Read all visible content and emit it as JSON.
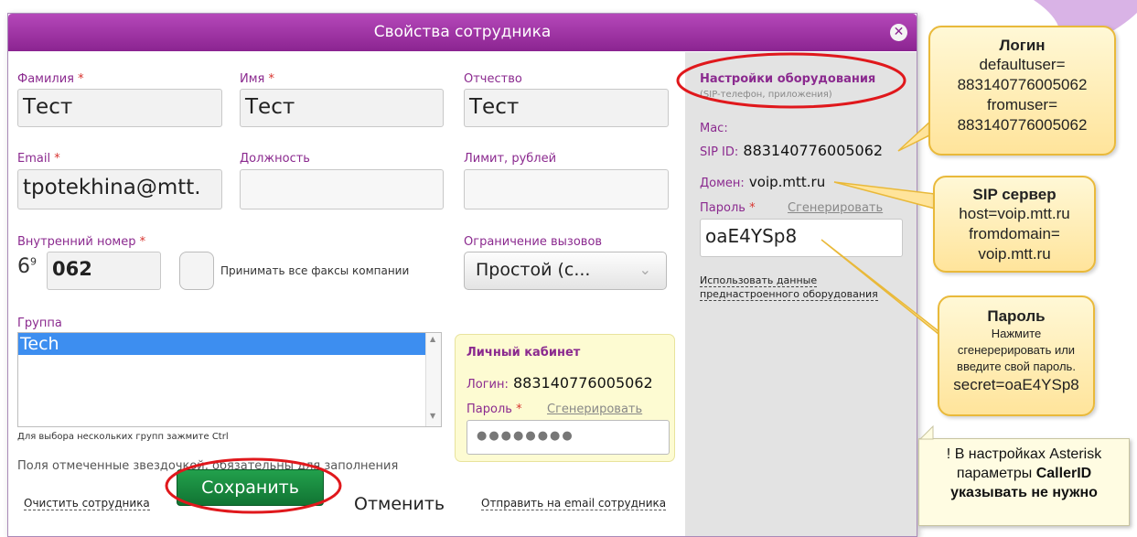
{
  "dialog": {
    "title": "Свойства сотрудника",
    "close_icon": "close-icon"
  },
  "fields": {
    "lastname_label": "Фамилия",
    "lastname_value": "Тест",
    "firstname_label": "Имя",
    "firstname_value": "Тест",
    "middlename_label": "Отчество",
    "middlename_value": "Тест",
    "email_label": "Email",
    "email_value": "tpotekhina@mtt.",
    "position_label": "Должность",
    "position_value": "",
    "limit_label": "Лимит, рублей",
    "limit_value": "",
    "ext_label": "Внутренний номер",
    "ext_prefix": "6",
    "ext_prefix_sup": "9",
    "ext_value": "062",
    "fax_label": "Принимать все факсы компании",
    "callrestrict_label": "Ограничение вызовов",
    "callrestrict_value": "Простой (с...",
    "required_mark": "*"
  },
  "group": {
    "label": "Группа",
    "selected": "Tech",
    "hint": "Для выбора нескольких групп зажмите Ctrl"
  },
  "required_note": "Поля отмеченные звездочкой, обязательны для заполнения",
  "cabinet": {
    "title": "Личный кабинет",
    "login_label": "Логин:",
    "login_value": "883140776005062",
    "password_label": "Пароль",
    "generate_link": "Сгенерировать",
    "password_value": "●●●●●●●●"
  },
  "hardware": {
    "title": "Настройки оборудования",
    "subtitle": "(SIP-телефон, приложения)",
    "mac_label": "Mac:",
    "sip_id_label": "SIP ID:",
    "sip_id_value": "883140776005062",
    "domain_label": "Домен:",
    "domain_value": "voip.mtt.ru",
    "password_label": "Пароль",
    "generate_link": "Сгенерировать",
    "password_value": "oaE4YSp8",
    "preset_line1": "Использовать данные",
    "preset_line2": "преднастроенного оборудования"
  },
  "actions": {
    "clear": "Очистить сотрудника",
    "save": "Сохранить",
    "cancel": "Отменить",
    "send_email": "Отправить на email сотрудника"
  },
  "callouts": {
    "login": {
      "title": "Логин",
      "l1": "defaultuser=",
      "l2": "883140776005062",
      "l3": "fromuser=",
      "l4": "883140776005062"
    },
    "sip": {
      "title": "SIP сервер",
      "l1": "host=voip.mtt.ru",
      "l2": "fromdomain=",
      "l3": "voip.mtt.ru"
    },
    "password": {
      "title": "Пароль",
      "l1": "Нажмите",
      "l2": "сгенерерировать или",
      "l3": "введите свой пароль.",
      "l4": "secret=oaE4YSp8"
    },
    "note": {
      "l1": "! В настройках Asterisk",
      "l2": "параметры",
      "l2b": "CallerID",
      "l3": "указывать не нужно"
    }
  },
  "colors": {
    "titlebar": "#9a2fa0",
    "accent": "#8b2a8f",
    "save": "#1a8a3f",
    "callout": "#ffe9a8",
    "highlight_ellipse": "#e0181c"
  }
}
